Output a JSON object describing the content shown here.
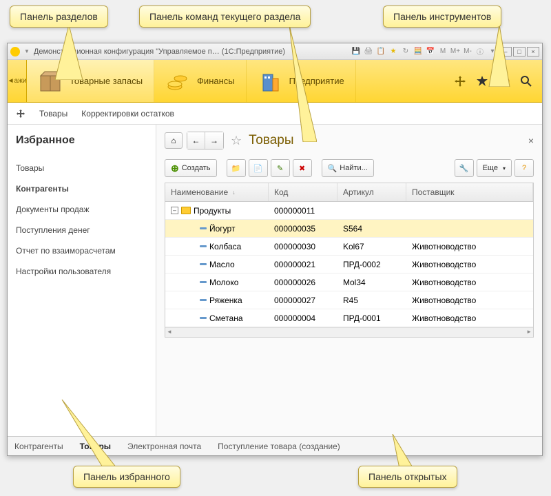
{
  "callouts": {
    "sections": "Панель разделов",
    "commands": "Панель команд текущего раздела",
    "tools": "Панель инструментов",
    "favorites": "Панель избранного",
    "open": "Панель открытых"
  },
  "titlebar": {
    "text": "Демонстрационная конфигурация \"Управляемое п…   (1С:Предприятие)"
  },
  "sections": {
    "nav_back": "ажи",
    "items": [
      {
        "label": "Товарные запасы"
      },
      {
        "label": "Финансы"
      },
      {
        "label": "Предприятие"
      }
    ]
  },
  "commands": {
    "items": [
      "Товары",
      "Корректировки остатков"
    ]
  },
  "favorites": {
    "title": "Избранное",
    "items": [
      {
        "label": "Товары",
        "bold": false
      },
      {
        "label": "Контрагенты",
        "bold": true
      },
      {
        "label": "Документы продаж",
        "bold": false
      },
      {
        "label": "Поступления денег",
        "bold": false
      },
      {
        "label": "Отчет по взаиморасчетам",
        "bold": false
      },
      {
        "label": "Настройки пользователя",
        "bold": false
      }
    ]
  },
  "content": {
    "title": "Товары",
    "toolbar": {
      "create": "Создать",
      "find": "Найти...",
      "more": "Еще"
    },
    "table": {
      "columns": [
        "Наименование",
        "Код",
        "Артикул",
        "Поставщик"
      ],
      "rows": [
        {
          "type": "group",
          "name": "Продукты",
          "code": "000000011",
          "article": "",
          "supplier": ""
        },
        {
          "type": "item",
          "selected": true,
          "name": "Йогурт",
          "code": "000000035",
          "article": "S564",
          "supplier": ""
        },
        {
          "type": "item",
          "name": "Колбаса",
          "code": "000000030",
          "article": "Kol67",
          "supplier": "Животноводство"
        },
        {
          "type": "item",
          "name": "Масло",
          "code": "000000021",
          "article": "ПРД-0002",
          "supplier": "Животноводство"
        },
        {
          "type": "item",
          "name": "Молоко",
          "code": "000000026",
          "article": "Mol34",
          "supplier": "Животноводство"
        },
        {
          "type": "item",
          "name": "Ряженка",
          "code": "000000027",
          "article": "R45",
          "supplier": "Животноводство"
        },
        {
          "type": "item",
          "name": "Сметана",
          "code": "000000004",
          "article": "ПРД-0001",
          "supplier": "Животноводство"
        }
      ]
    }
  },
  "open_panel": {
    "items": [
      {
        "label": "Контрагенты",
        "active": false
      },
      {
        "label": "Товары",
        "active": true
      },
      {
        "label": "Электронная почта",
        "active": false
      },
      {
        "label": "Поступление товара (создание)",
        "active": false
      }
    ]
  }
}
